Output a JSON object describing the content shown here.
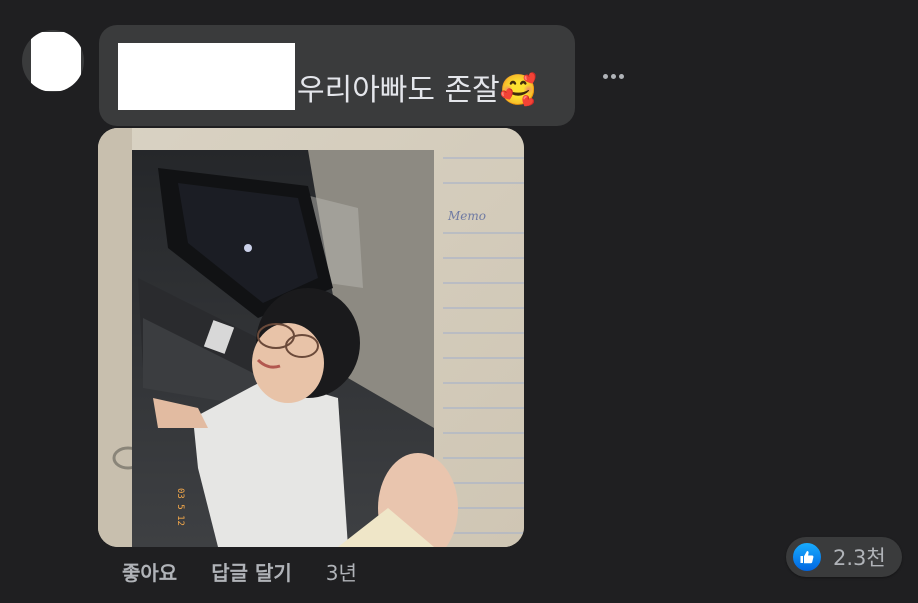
{
  "comment": {
    "text": "우리아빠도 존잘🥰",
    "more_icon": "more-horizontal-icon"
  },
  "actions": {
    "like_label": "좋아요",
    "reply_label": "답글 달기",
    "timestamp": "3년"
  },
  "reactions": {
    "icon": "like-thumbs-up-icon",
    "count": "2.3천",
    "like_color": "#1877f2"
  },
  "colors": {
    "background": "#1f1f21",
    "bubble": "#3a3b3c",
    "secondary_text": "#b0b3b8"
  }
}
